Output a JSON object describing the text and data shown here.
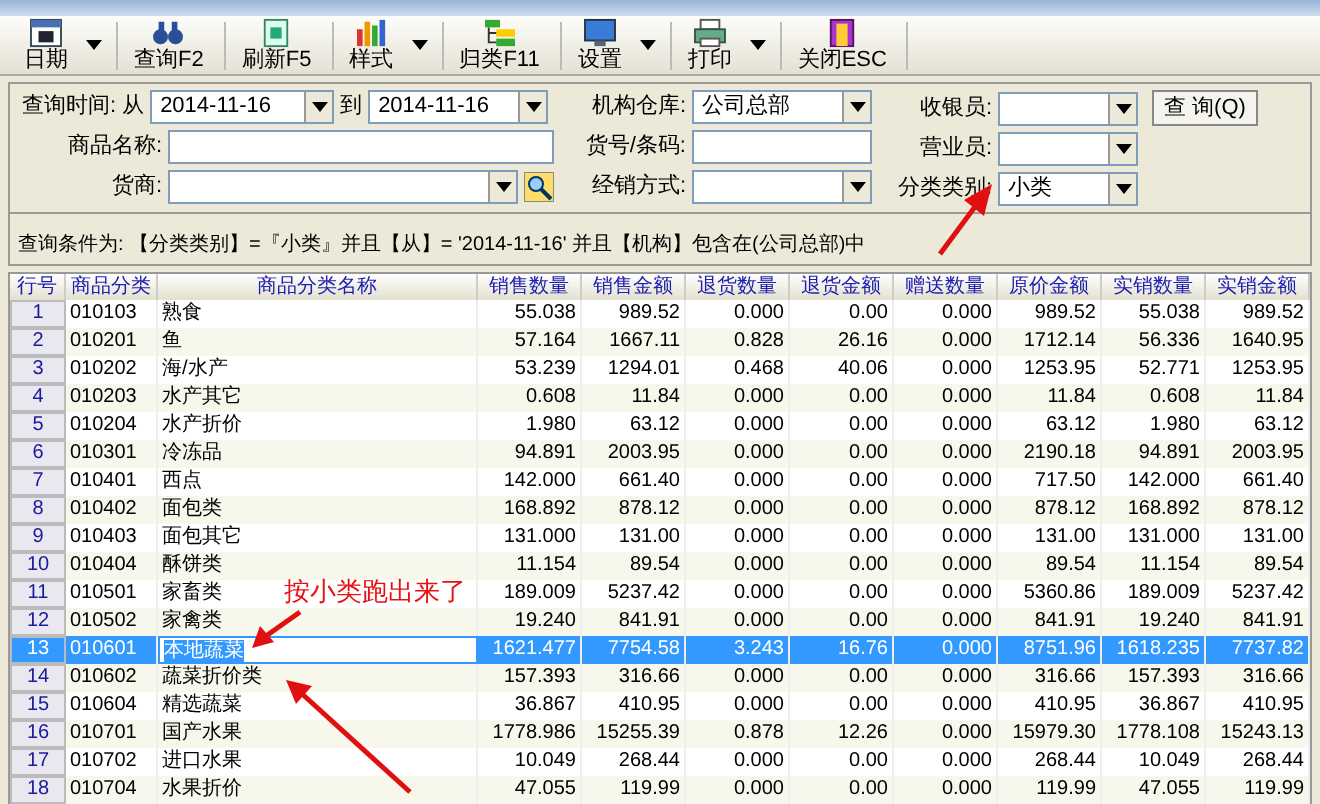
{
  "toolbar": [
    {
      "label": "日期",
      "dropdown": true
    },
    {
      "label": "查询F2",
      "dropdown": false
    },
    {
      "label": "刷新F5",
      "dropdown": false
    },
    {
      "label": "样式",
      "dropdown": true
    },
    {
      "label": "归类F11",
      "dropdown": false
    },
    {
      "label": "设置",
      "dropdown": true
    },
    {
      "label": "打印",
      "dropdown": true
    },
    {
      "label": "关闭ESC",
      "dropdown": false
    }
  ],
  "query": {
    "time_label": "查询时间:",
    "from_label": "从",
    "from": "2014-11-16",
    "to_label": "到",
    "to": "2014-11-16",
    "product_label": "商品名称:",
    "supplier_label": "货商:",
    "warehouse_label": "机构仓库:",
    "warehouse": "公司总部",
    "code_label": "货号/条码:",
    "dealer_label": "经销方式:",
    "cashier_label": "收银员:",
    "clerk_label": "营业员:",
    "category_label": "分类类别:",
    "category": "小类",
    "search_button": "查 询(Q)"
  },
  "condition": "查询条件为: 【分类类别】=『小类』并且【从】= '2014-11-16' 并且【机构】包含在(公司总部)中",
  "table": {
    "columns": [
      "行号",
      "商品分类",
      "商品分类名称",
      "销售数量",
      "销售金额",
      "退货数量",
      "退货金额",
      "赠送数量",
      "原价金额",
      "实销数量",
      "实销金额"
    ],
    "rows": [
      {
        "cells": [
          "1",
          "010103",
          "熟食",
          "55.038",
          "989.52",
          "0.000",
          "0.00",
          "0.000",
          "989.52",
          "55.038",
          "989.52"
        ],
        "selected": false
      },
      {
        "cells": [
          "2",
          "010201",
          "鱼",
          "57.164",
          "1667.11",
          "0.828",
          "26.16",
          "0.000",
          "1712.14",
          "56.336",
          "1640.95"
        ],
        "selected": false
      },
      {
        "cells": [
          "3",
          "010202",
          "海/水产",
          "53.239",
          "1294.01",
          "0.468",
          "40.06",
          "0.000",
          "1253.95",
          "52.771",
          "1253.95"
        ],
        "selected": false
      },
      {
        "cells": [
          "4",
          "010203",
          "水产其它",
          "0.608",
          "11.84",
          "0.000",
          "0.00",
          "0.000",
          "11.84",
          "0.608",
          "11.84"
        ],
        "selected": false
      },
      {
        "cells": [
          "5",
          "010204",
          "水产折价",
          "1.980",
          "63.12",
          "0.000",
          "0.00",
          "0.000",
          "63.12",
          "1.980",
          "63.12"
        ],
        "selected": false
      },
      {
        "cells": [
          "6",
          "010301",
          "冷冻品",
          "94.891",
          "2003.95",
          "0.000",
          "0.00",
          "0.000",
          "2190.18",
          "94.891",
          "2003.95"
        ],
        "selected": false
      },
      {
        "cells": [
          "7",
          "010401",
          "西点",
          "142.000",
          "661.40",
          "0.000",
          "0.00",
          "0.000",
          "717.50",
          "142.000",
          "661.40"
        ],
        "selected": false
      },
      {
        "cells": [
          "8",
          "010402",
          "面包类",
          "168.892",
          "878.12",
          "0.000",
          "0.00",
          "0.000",
          "878.12",
          "168.892",
          "878.12"
        ],
        "selected": false
      },
      {
        "cells": [
          "9",
          "010403",
          "面包其它",
          "131.000",
          "131.00",
          "0.000",
          "0.00",
          "0.000",
          "131.00",
          "131.000",
          "131.00"
        ],
        "selected": false
      },
      {
        "cells": [
          "10",
          "010404",
          "酥饼类",
          "11.154",
          "89.54",
          "0.000",
          "0.00",
          "0.000",
          "89.54",
          "11.154",
          "89.54"
        ],
        "selected": false
      },
      {
        "cells": [
          "11",
          "010501",
          "家畜类",
          "189.009",
          "5237.42",
          "0.000",
          "0.00",
          "0.000",
          "5360.86",
          "189.009",
          "5237.42"
        ],
        "selected": false
      },
      {
        "cells": [
          "12",
          "010502",
          "家禽类",
          "19.240",
          "841.91",
          "0.000",
          "0.00",
          "0.000",
          "841.91",
          "19.240",
          "841.91"
        ],
        "selected": false
      },
      {
        "cells": [
          "13",
          "010601",
          "本地蔬菜",
          "1621.477",
          "7754.58",
          "3.243",
          "16.76",
          "0.000",
          "8751.96",
          "1618.235",
          "7737.82"
        ],
        "selected": true
      },
      {
        "cells": [
          "14",
          "010602",
          "蔬菜折价类",
          "157.393",
          "316.66",
          "0.000",
          "0.00",
          "0.000",
          "316.66",
          "157.393",
          "316.66"
        ],
        "selected": false
      },
      {
        "cells": [
          "15",
          "010604",
          "精选蔬菜",
          "36.867",
          "410.95",
          "0.000",
          "0.00",
          "0.000",
          "410.95",
          "36.867",
          "410.95"
        ],
        "selected": false
      },
      {
        "cells": [
          "16",
          "010701",
          "国产水果",
          "1778.986",
          "15255.39",
          "0.878",
          "12.26",
          "0.000",
          "15979.30",
          "1778.108",
          "15243.13"
        ],
        "selected": false
      },
      {
        "cells": [
          "17",
          "010702",
          "进口水果",
          "10.049",
          "268.44",
          "0.000",
          "0.00",
          "0.000",
          "268.44",
          "10.049",
          "268.44"
        ],
        "selected": false
      },
      {
        "cells": [
          "18",
          "010704",
          "水果折价",
          "47.055",
          "119.99",
          "0.000",
          "0.00",
          "0.000",
          "119.99",
          "47.055",
          "119.99"
        ],
        "selected": false
      }
    ]
  },
  "annotation": "按小类跑出来了"
}
